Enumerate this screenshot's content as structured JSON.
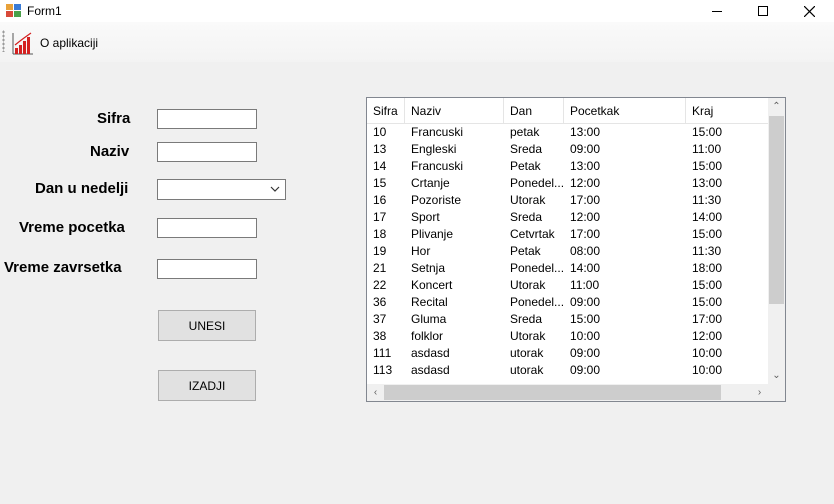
{
  "window": {
    "title": "Form1",
    "minimize_icon": "minimize-icon",
    "maximize_icon": "maximize-icon",
    "close_icon": "close-icon"
  },
  "menu": {
    "items": [
      {
        "label": "O aplikaciji",
        "icon": "bar-chart-icon"
      }
    ]
  },
  "form": {
    "sifra_label": "Sifra",
    "naziv_label": "Naziv",
    "dan_label": "Dan u nedelji",
    "pocetak_label": "Vreme pocetka",
    "zavrsetak_label": "Vreme zavrsetka",
    "sifra_value": "",
    "naziv_value": "",
    "dan_value": "",
    "pocetak_value": "",
    "zavrsetak_value": "",
    "unesi_label": "UNESI",
    "izadji_label": "IZADJI"
  },
  "grid": {
    "columns": [
      "Sifra",
      "Naziv",
      "Dan",
      "Pocetkak",
      "Kraj"
    ],
    "rows": [
      [
        "10",
        "Francuski",
        "petak",
        "13:00",
        "15:00"
      ],
      [
        "13",
        "Engleski",
        "Sreda",
        "09:00",
        "11:00"
      ],
      [
        "14",
        "Francuski",
        "Petak",
        "13:00",
        "15:00"
      ],
      [
        "15",
        "Crtanje",
        "Ponedel...",
        "12:00",
        "13:00"
      ],
      [
        "16",
        "Pozoriste",
        "Utorak",
        "17:00",
        "11:30"
      ],
      [
        "17",
        "Sport",
        "Sreda",
        "12:00",
        "14:00"
      ],
      [
        "18",
        "Plivanje",
        "Cetvrtak",
        "17:00",
        "15:00"
      ],
      [
        "19",
        "Hor",
        "Petak",
        "08:00",
        "11:30"
      ],
      [
        "21",
        "Setnja",
        "Ponedel...",
        "14:00",
        "18:00"
      ],
      [
        "22",
        "Koncert",
        "Utorak",
        "11:00",
        "15:00"
      ],
      [
        "36",
        "Recital",
        "Ponedel...",
        "09:00",
        "15:00"
      ],
      [
        "37",
        "Gluma",
        "Sreda",
        "15:00",
        "17:00"
      ],
      [
        "38",
        "folklor",
        "Utorak",
        "10:00",
        "12:00"
      ],
      [
        "111",
        "asdasd",
        "utorak",
        "09:00",
        "10:00"
      ],
      [
        "113",
        "asdasd",
        "utorak",
        "09:00",
        "10:00"
      ]
    ]
  },
  "colors": {
    "background": "#f0f0f0",
    "button": "#e1e1e1",
    "accent_icon": "#d42020"
  }
}
